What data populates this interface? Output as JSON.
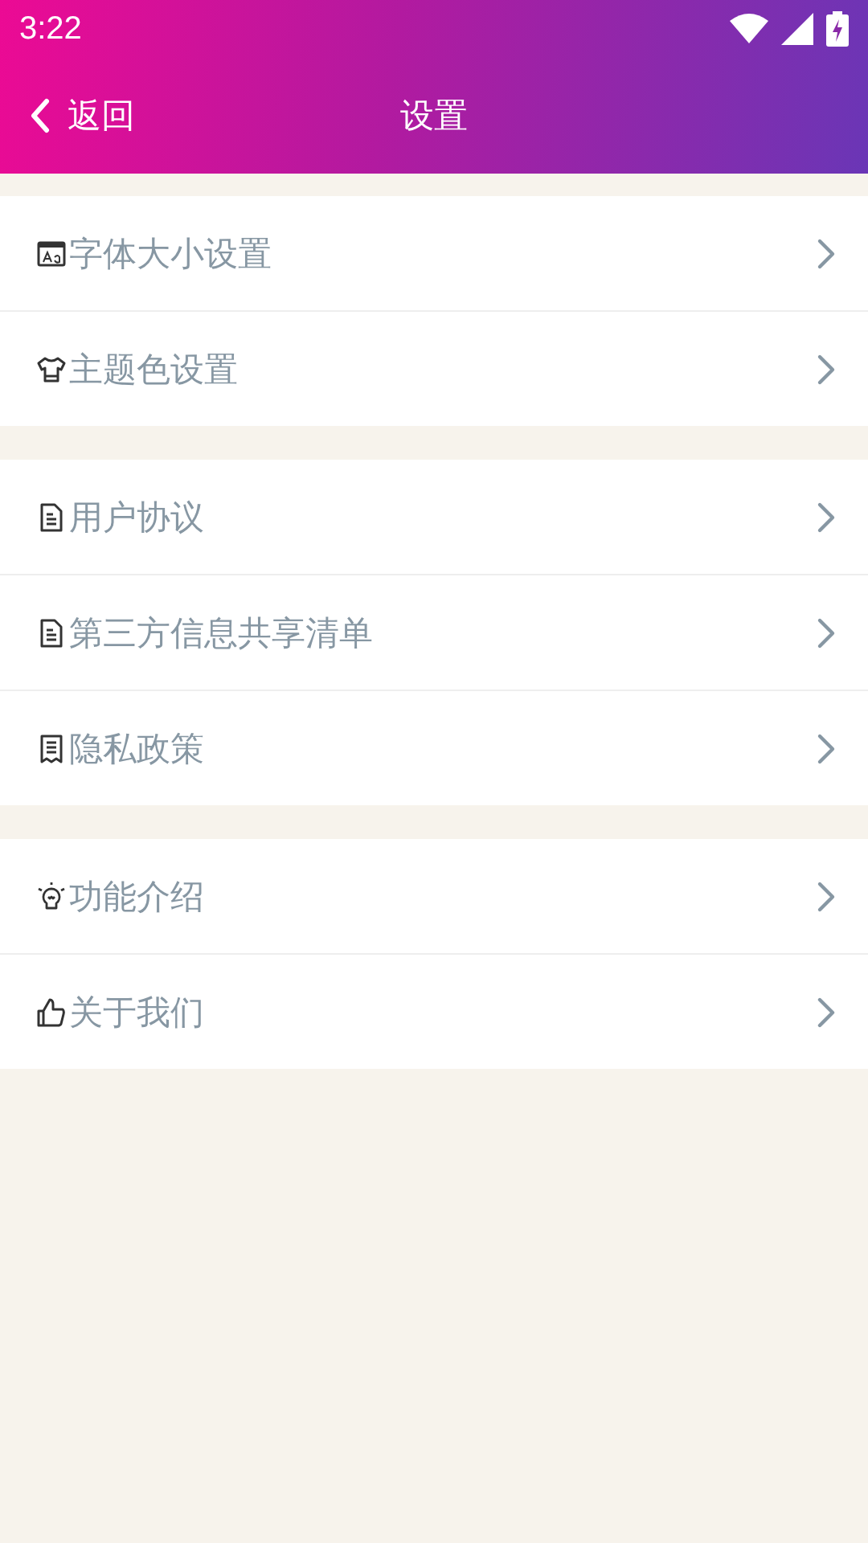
{
  "status_bar": {
    "time": "3:22"
  },
  "header": {
    "back_label": "返回",
    "title": "设置"
  },
  "groups": [
    {
      "items": [
        {
          "kind": "font",
          "label": "字体大小设置"
        },
        {
          "kind": "shirt",
          "label": "主题色设置"
        }
      ]
    },
    {
      "items": [
        {
          "kind": "doc",
          "label": "用户协议"
        },
        {
          "kind": "doc",
          "label": "第三方信息共享清单"
        },
        {
          "kind": "receipt",
          "label": "隐私政策"
        }
      ]
    },
    {
      "items": [
        {
          "kind": "bulb",
          "label": "功能介绍"
        },
        {
          "kind": "thumb",
          "label": "关于我们"
        }
      ]
    }
  ]
}
